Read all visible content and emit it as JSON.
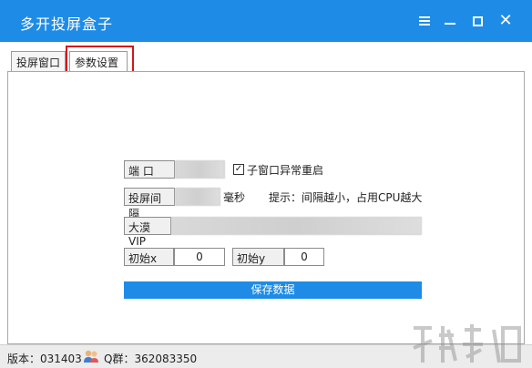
{
  "window": {
    "title": "多开投屏盒子",
    "menu_icon": "hamburger-icon",
    "min_icon": "minimize-icon",
    "max_icon": "maximize-icon",
    "close_icon": "close-icon",
    "close_glyph": "✕"
  },
  "tabs": [
    {
      "label": "投屏窗口",
      "active": false
    },
    {
      "label": "参数设置",
      "active": true
    }
  ],
  "settings": {
    "port_label": "端 口",
    "restart_checkbox_label": "子窗口异常重启",
    "restart_checked": true,
    "check_glyph": "✓",
    "interval_label": "投屏间隔",
    "interval_unit": "毫秒",
    "interval_hint": "提示：间隔越小，占用CPU越大",
    "vip_label": "大漠VIP",
    "init_x_label": "初始x",
    "init_x_value": "0",
    "init_y_label": "初始y",
    "init_y_value": "0",
    "save_label": "保存数据"
  },
  "status": {
    "version": "版本：031403",
    "qq": "Q群：362083350"
  },
  "colors": {
    "accent": "#1e8ce6",
    "highlight": "#d0181c"
  }
}
